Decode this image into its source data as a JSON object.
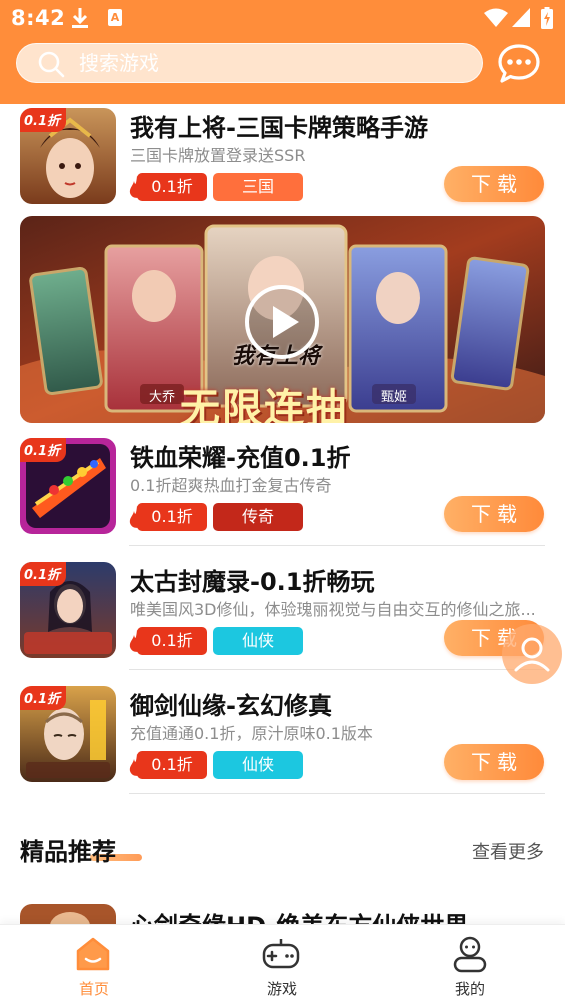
{
  "colors": {
    "accent": "#ff8d3a",
    "discount_red": "#e8361b",
    "genre_orange": "#ff6f3c",
    "genre_dark_red": "#c3281a",
    "genre_cyan": "#1cc7e0"
  },
  "status_bar": {
    "time": "8:42",
    "icons": [
      "download-icon",
      "notification-icon",
      "wifi-icon",
      "signal-icon",
      "battery-icon"
    ]
  },
  "search": {
    "placeholder": "搜索游戏",
    "icon": "search-icon"
  },
  "chat": {
    "icon": "chat-icon"
  },
  "games": [
    {
      "badge": "0.1折",
      "title": "我有上将-三国卡牌策略手游",
      "desc": "三国卡牌放置登录送SSR",
      "discount_tag": "0.1折",
      "genre": "三国",
      "genre_color": "#ff6f3c",
      "download": "下载"
    },
    {
      "badge": "0.1折",
      "title": "铁血荣耀-充值0.1折",
      "desc": "0.1折超爽热血打金复古传奇",
      "discount_tag": "0.1折",
      "genre": "传奇",
      "genre_color": "#c3281a",
      "download": "下载"
    },
    {
      "badge": "0.1折",
      "title": "太古封魔录-0.1折畅玩",
      "desc": "唯美国风3D修仙，体验瑰丽视觉与自由交互的修仙之旅...",
      "discount_tag": "0.1折",
      "genre": "仙侠",
      "genre_color": "#1cc7e0",
      "download": "下载"
    },
    {
      "badge": "0.1折",
      "title": "御剑仙缘-玄幻修真",
      "desc": "充值通通0.1折，原汁原味0.1版本",
      "discount_tag": "0.1折",
      "genre": "仙侠",
      "genre_color": "#1cc7e0",
      "download": "下载"
    }
  ],
  "banner": {
    "caption": "无限连抽",
    "logo_text": "我有上将",
    "card_names": [
      "大乔",
      "甄姬"
    ],
    "icon": "play-icon"
  },
  "section": {
    "title": "精品推荐",
    "more": "查看更多"
  },
  "partial_game": {
    "title": "心剑奇缘HD-绝美东方仙侠世界"
  },
  "tabs": [
    {
      "label": "首页",
      "icon": "home-icon",
      "active": true
    },
    {
      "label": "游戏",
      "icon": "gamepad-icon",
      "active": false
    },
    {
      "label": "我的",
      "icon": "profile-icon",
      "active": false
    }
  ]
}
